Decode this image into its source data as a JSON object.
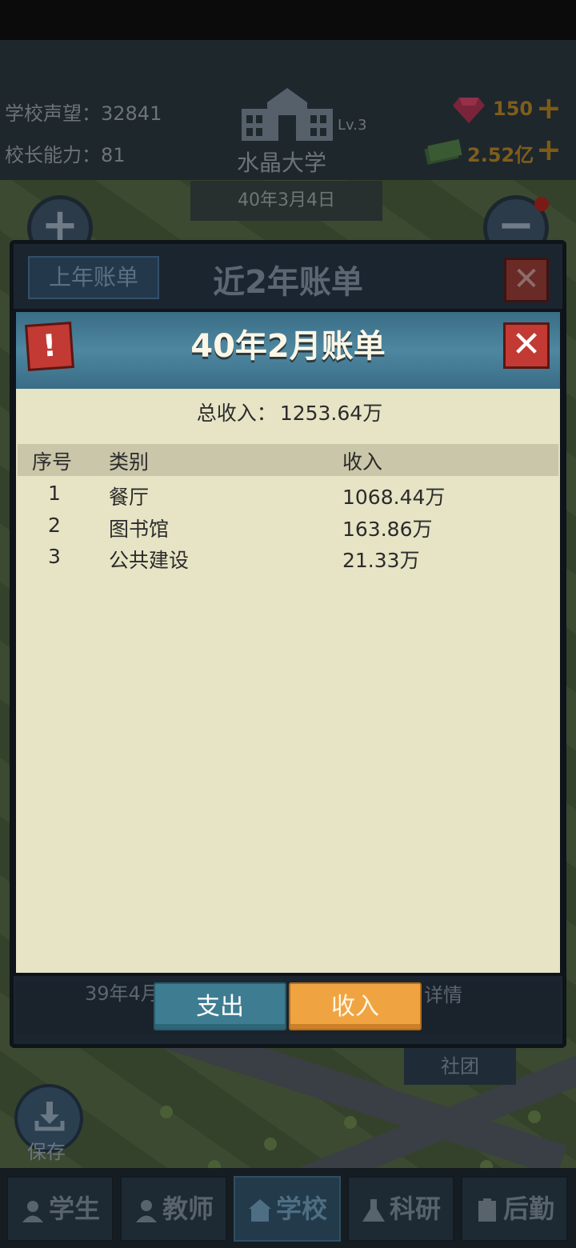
{
  "header": {
    "reputation_label": "学校声望：",
    "reputation_value": "32841",
    "principal_label": "校长能力：",
    "principal_value": "81",
    "school_name": "水晶大学",
    "level": "Lv.3",
    "date": "40年3月4日",
    "gems": "150",
    "money": "2.52亿"
  },
  "outer_panel": {
    "title": "近2年账单",
    "prev_year_button": "上年账单",
    "behind_date": "39年4月",
    "behind_detail": "详情",
    "club_tag": "社团"
  },
  "dialog": {
    "title": "40年2月账单",
    "alert_icon": "!",
    "total_label": "总收入：",
    "total_value": "1253.64万",
    "columns": {
      "index": "序号",
      "category": "类别",
      "amount": "收入"
    },
    "rows": [
      {
        "index": "1",
        "category": "餐厅",
        "amount": "1068.44万"
      },
      {
        "index": "2",
        "category": "图书馆",
        "amount": "163.86万"
      },
      {
        "index": "3",
        "category": "公共建设",
        "amount": "21.33万"
      }
    ],
    "tabs": {
      "expense": "支出",
      "income": "收入"
    }
  },
  "save_label": "保存",
  "nav": [
    "学生",
    "教师",
    "学校",
    "科研",
    "后勤"
  ],
  "colors": {
    "accent_gold": "#f0a441",
    "teal": "#3e7d91",
    "danger": "#c23a33",
    "dialog_bg": "#e6e4c5"
  }
}
